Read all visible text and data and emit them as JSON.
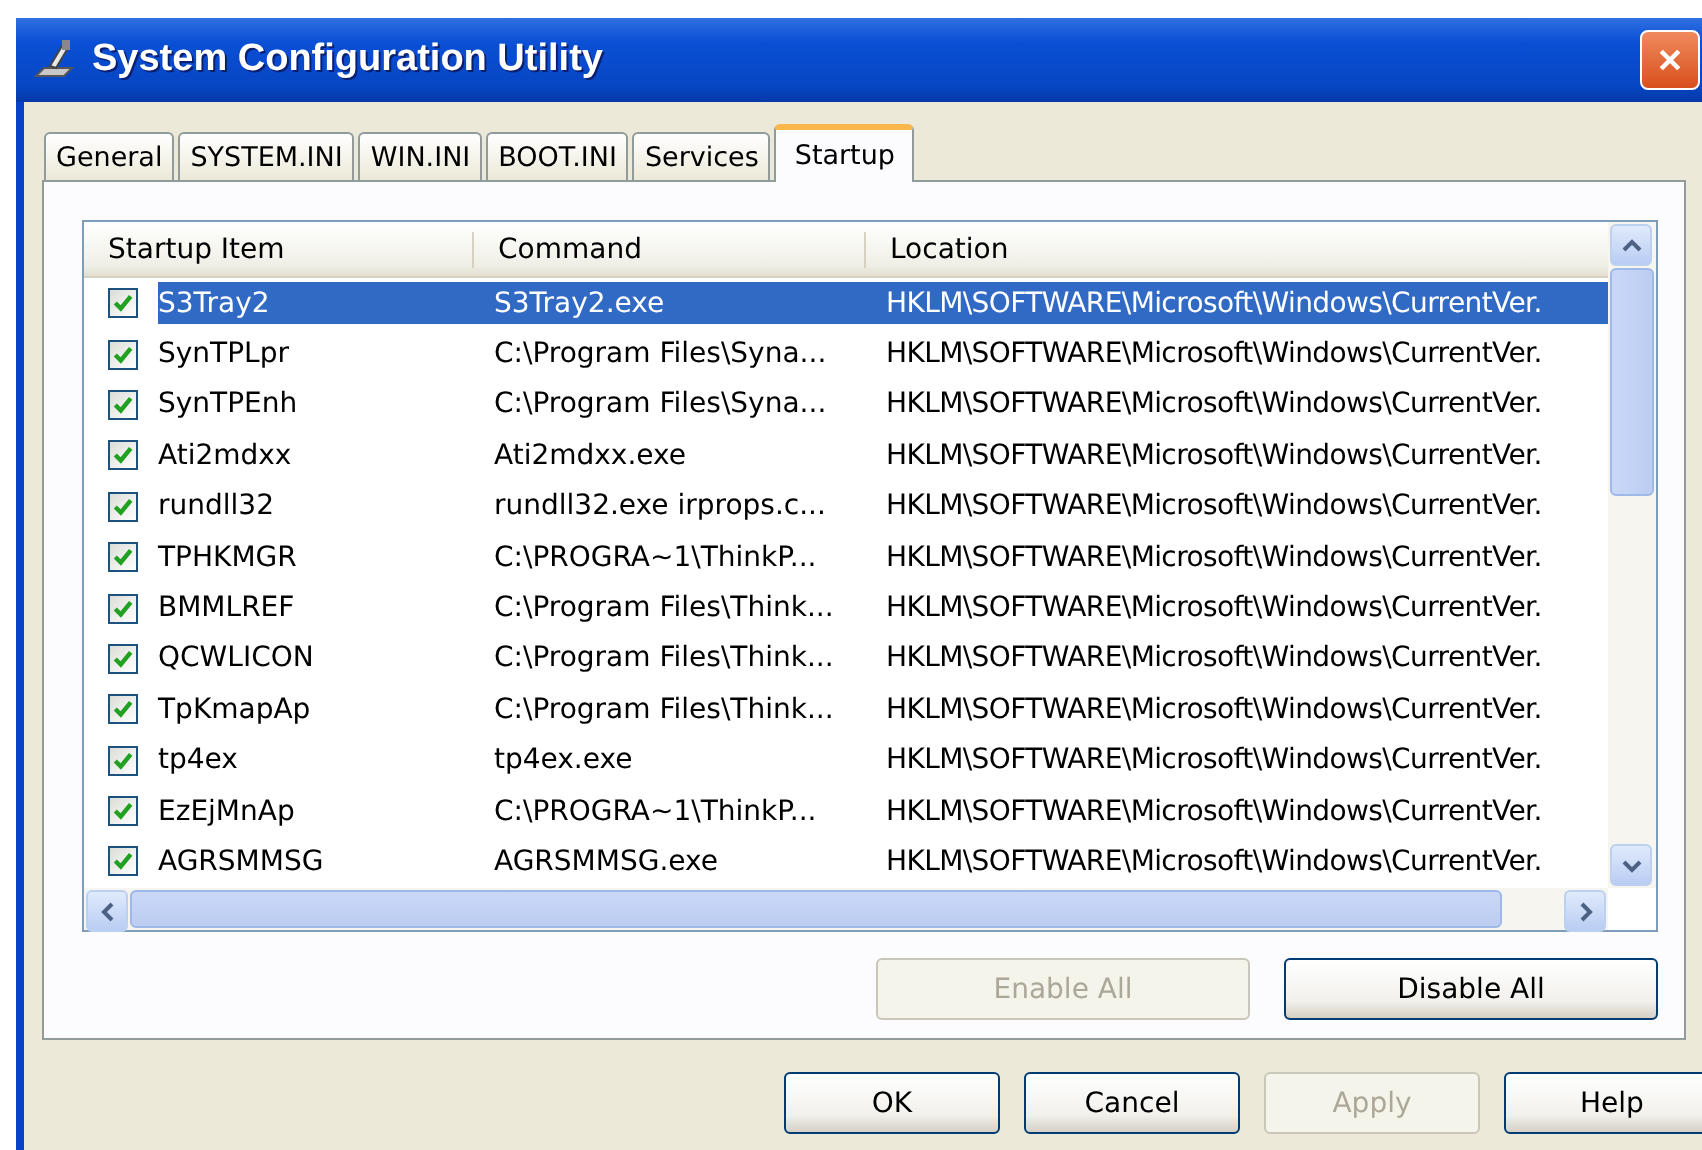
{
  "window": {
    "title": "System Configuration Utility"
  },
  "tabs": [
    {
      "label": "General",
      "selected": false
    },
    {
      "label": "SYSTEM.INI",
      "selected": false
    },
    {
      "label": "WIN.INI",
      "selected": false
    },
    {
      "label": "BOOT.INI",
      "selected": false
    },
    {
      "label": "Services",
      "selected": false
    },
    {
      "label": "Startup",
      "selected": true
    }
  ],
  "table": {
    "columns": [
      "Startup Item",
      "Command",
      "Location"
    ],
    "rows": [
      {
        "checked": true,
        "selected": true,
        "cells": [
          "S3Tray2",
          "S3Tray2.exe",
          "HKLM\\SOFTWARE\\Microsoft\\Windows\\CurrentVer."
        ]
      },
      {
        "checked": true,
        "selected": false,
        "cells": [
          "SynTPLpr",
          "C:\\Program Files\\Syna...",
          "HKLM\\SOFTWARE\\Microsoft\\Windows\\CurrentVer."
        ]
      },
      {
        "checked": true,
        "selected": false,
        "cells": [
          "SynTPEnh",
          "C:\\Program Files\\Syna...",
          "HKLM\\SOFTWARE\\Microsoft\\Windows\\CurrentVer."
        ]
      },
      {
        "checked": true,
        "selected": false,
        "cells": [
          "Ati2mdxx",
          "Ati2mdxx.exe",
          "HKLM\\SOFTWARE\\Microsoft\\Windows\\CurrentVer."
        ]
      },
      {
        "checked": true,
        "selected": false,
        "cells": [
          "rundll32",
          "rundll32.exe irprops.c...",
          "HKLM\\SOFTWARE\\Microsoft\\Windows\\CurrentVer."
        ]
      },
      {
        "checked": true,
        "selected": false,
        "cells": [
          "TPHKMGR",
          "C:\\PROGRA~1\\ThinkP...",
          "HKLM\\SOFTWARE\\Microsoft\\Windows\\CurrentVer."
        ]
      },
      {
        "checked": true,
        "selected": false,
        "cells": [
          "BMMLREF",
          "C:\\Program Files\\Think...",
          "HKLM\\SOFTWARE\\Microsoft\\Windows\\CurrentVer."
        ]
      },
      {
        "checked": true,
        "selected": false,
        "cells": [
          "QCWLICON",
          "C:\\Program Files\\Think...",
          "HKLM\\SOFTWARE\\Microsoft\\Windows\\CurrentVer."
        ]
      },
      {
        "checked": true,
        "selected": false,
        "cells": [
          "TpKmapAp",
          "C:\\Program Files\\Think...",
          "HKLM\\SOFTWARE\\Microsoft\\Windows\\CurrentVer."
        ]
      },
      {
        "checked": true,
        "selected": false,
        "cells": [
          "tp4ex",
          "tp4ex.exe",
          "HKLM\\SOFTWARE\\Microsoft\\Windows\\CurrentVer."
        ]
      },
      {
        "checked": true,
        "selected": false,
        "cells": [
          "EzEjMnAp",
          "C:\\PROGRA~1\\ThinkP...",
          "HKLM\\SOFTWARE\\Microsoft\\Windows\\CurrentVer."
        ]
      },
      {
        "checked": true,
        "selected": false,
        "cells": [
          "AGRSMMSG",
          "AGRSMMSG.exe",
          "HKLM\\SOFTWARE\\Microsoft\\Windows\\CurrentVer."
        ]
      }
    ]
  },
  "panel_buttons": [
    {
      "label": "Enable All",
      "disabled": true
    },
    {
      "label": "Disable All",
      "disabled": false
    }
  ],
  "buttons": [
    {
      "label": "OK",
      "disabled": false
    },
    {
      "label": "Cancel",
      "disabled": false
    },
    {
      "label": "Apply",
      "disabled": true
    },
    {
      "label": "Help",
      "disabled": false
    }
  ]
}
